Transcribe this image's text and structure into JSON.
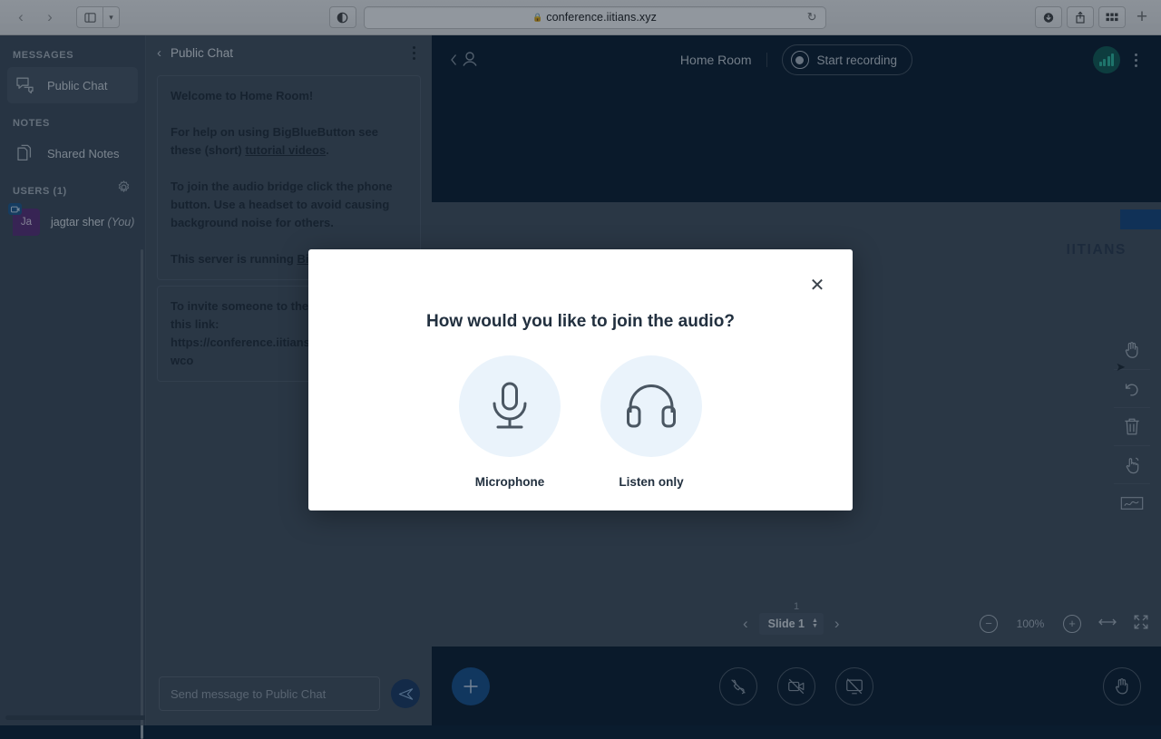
{
  "browser": {
    "back_icon": "chevron-left",
    "forward_icon": "chevron-right",
    "sidebar_icon": "sidebar-panel",
    "caret_icon": "chevron-down",
    "shield_icon": "reader-contrast",
    "url": "conference.iitians.xyz",
    "lock_icon": "lock",
    "reload_icon": "reload",
    "download_icon": "download",
    "share_icon": "share",
    "tabs_icon": "tab-overview",
    "newtab_label": "+"
  },
  "sidebar": {
    "messages_title": "MESSAGES",
    "public_chat_label": "Public Chat",
    "notes_title": "NOTES",
    "shared_notes_label": "Shared Notes",
    "users_title": "USERS (1)",
    "settings_icon": "gear-icon",
    "user": {
      "initials": "Ja",
      "name": "jagtar sher ",
      "you_suffix": "(You)"
    }
  },
  "chat": {
    "title": "Public Chat",
    "back_icon": "chevron-left",
    "options_icon": "kebab-menu",
    "messages": [
      {
        "lines": [
          "Welcome to Home Room!",
          "For help on using BigBlueButton see these (short) tutorial videos.",
          "To join the audio bridge click the phone button. Use a headset to avoid causing background noise for others.",
          "This server is running BigBlueButton."
        ]
      },
      {
        "lines": [
          "To invite someone to the meeting, send them this link:",
          "https://conference.iitians.xyz/b/jag-2mr-owu-wco"
        ]
      }
    ],
    "input_placeholder": "Send message to Public Chat",
    "input_value": "",
    "send_icon": "send-icon"
  },
  "meeting": {
    "userlist_toggle_icon": "user-toggle-icon",
    "room_title": "Home Room",
    "record_label": "Start recording",
    "record_icon": "record-dot-icon",
    "connection_icon": "connection-bars-icon",
    "options_icon": "kebab-menu"
  },
  "presentation": {
    "logo_text": "IITIANS",
    "page_number": "1",
    "prev_icon": "chevron-left",
    "next_icon": "chevron-right",
    "slide_label": "Slide 1",
    "zoom_out_icon": "minus-circle-icon",
    "zoom_value": "100%",
    "zoom_in_icon": "plus-circle-icon",
    "fit_width_icon": "fit-to-width-icon",
    "fullscreen_icon": "fullscreen-icon"
  },
  "whiteboard_tools": [
    {
      "name": "pan-tool",
      "icon": "hand-icon"
    },
    {
      "name": "undo-tool",
      "icon": "undo-arrow-icon"
    },
    {
      "name": "clear-all-tool",
      "icon": "trash-icon"
    },
    {
      "name": "multi-user-tool",
      "icon": "hand-pointer-icon"
    },
    {
      "name": "pencil-tool",
      "icon": "pencil-line-icon"
    }
  ],
  "actions": {
    "add_label": "+",
    "add_icon": "plus-icon",
    "audio_icon": "phone-slash-icon",
    "video_icon": "camera-off-icon",
    "screenshare_icon": "screen-share-off-icon",
    "raisehand_icon": "raise-hand-icon"
  },
  "modal": {
    "title": "How would you like to join the audio?",
    "close_icon": "close-icon",
    "options": [
      {
        "label": "Microphone",
        "icon": "microphone-icon"
      },
      {
        "label": "Listen only",
        "icon": "headphones-icon"
      }
    ]
  },
  "colors": {
    "accent_blue": "#17508d",
    "sidebar": "#3e4b59",
    "chat_panel": "#44505e",
    "dark_navy": "#0a1c2e",
    "connection_green": "#2fbfa2",
    "avatar_purple": "#5b2e78",
    "modal_icon_bg": "#eaf3fb"
  }
}
